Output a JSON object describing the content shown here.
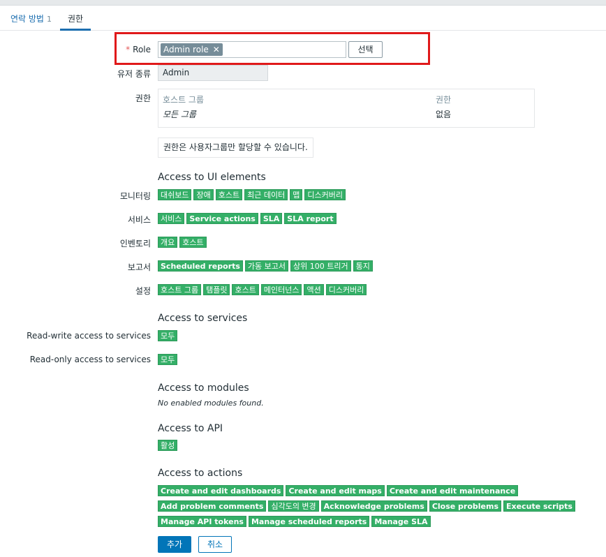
{
  "tabs": {
    "contacts": "연락 방법",
    "contacts_count": "1",
    "permissions": "권한"
  },
  "role": {
    "label": "Role",
    "required": "*",
    "chip": "Admin role",
    "chip_remove": "✕",
    "select_button": "선택"
  },
  "user_type": {
    "label": "유저 종류",
    "value": "Admin"
  },
  "permissions": {
    "label": "권한",
    "col_group": "호스트 그룹",
    "col_perm": "권한",
    "row_group": "모든 그룹",
    "row_perm": "없음",
    "note": "권한은 사용자그룹만 할당할 수 있습니다."
  },
  "ui_access": {
    "title": "Access to UI elements",
    "rows": [
      {
        "label": "모니터링",
        "tags": [
          "대쉬보드",
          "장애",
          "호스트",
          "최근 데이터",
          "맵",
          "디스커버리"
        ]
      },
      {
        "label": "서비스",
        "tags": [
          "서비스",
          "Service actions",
          "SLA",
          "SLA report"
        ]
      },
      {
        "label": "인벤토리",
        "tags": [
          "개요",
          "호스트"
        ]
      },
      {
        "label": "보고서",
        "tags": [
          "Scheduled reports",
          "가동 보고서",
          "상위 100 트리거",
          "통지"
        ]
      },
      {
        "label": "설정",
        "tags": [
          "호스트 그룹",
          "탬플릿",
          "호스트",
          "메인터넌스",
          "액션",
          "디스커버리"
        ]
      }
    ]
  },
  "services_access": {
    "title": "Access to services",
    "read_write_label": "Read-write access to services",
    "read_write_value": "모두",
    "read_only_label": "Read-only access to services",
    "read_only_value": "모두"
  },
  "modules_access": {
    "title": "Access to modules",
    "note": "No enabled modules found."
  },
  "api_access": {
    "title": "Access to API",
    "value": "활성"
  },
  "actions_access": {
    "title": "Access to actions",
    "rows": [
      [
        "Create and edit dashboards",
        "Create and edit maps",
        "Create and edit maintenance"
      ],
      [
        "Add problem comments",
        "심각도의 변경",
        "Acknowledge problems",
        "Close problems",
        "Execute scripts"
      ],
      [
        "Manage API tokens",
        "Manage scheduled reports",
        "Manage SLA"
      ]
    ]
  },
  "buttons": {
    "add": "추가",
    "cancel": "취소"
  },
  "colors": {
    "accent": "#0275b8",
    "tag_green": "#34af67",
    "highlight_red": "#e0191a"
  }
}
